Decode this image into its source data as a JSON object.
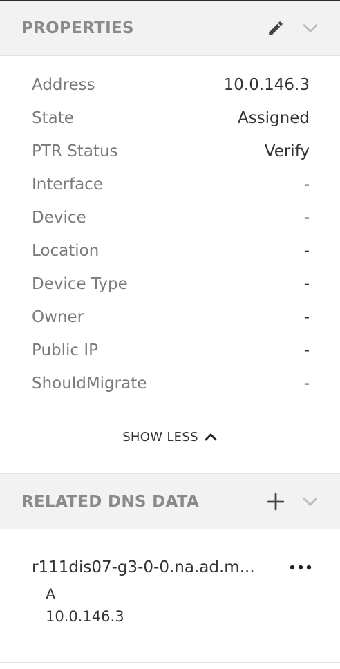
{
  "properties": {
    "title": "PROPERTIES",
    "rows": [
      {
        "label": "Address",
        "value": "10.0.146.3"
      },
      {
        "label": "State",
        "value": "Assigned"
      },
      {
        "label": "PTR Status",
        "value": "Verify"
      },
      {
        "label": "Interface",
        "value": "-"
      },
      {
        "label": "Device",
        "value": "-"
      },
      {
        "label": "Location",
        "value": "-"
      },
      {
        "label": "Device Type",
        "value": "-"
      },
      {
        "label": "Owner",
        "value": "-"
      },
      {
        "label": "Public IP",
        "value": "-"
      },
      {
        "label": "ShouldMigrate",
        "value": "-"
      }
    ],
    "toggle_label": "SHOW LESS",
    "icons": {
      "edit": "pencil-icon",
      "collapse": "chevron-down-icon",
      "toggle": "chevron-up-icon"
    }
  },
  "dns": {
    "title": "RELATED DNS DATA",
    "record": {
      "name": "r111dis07-g3-0-0.na.ad.m...",
      "type": "A",
      "value": "10.0.146.3"
    },
    "icons": {
      "add": "plus-icon",
      "collapse": "chevron-down-icon",
      "more": "more-icon"
    }
  },
  "colors": {
    "header_bg": "#f2f2f2",
    "header_text": "#8a8a8a",
    "border": "#e3e3e3"
  }
}
